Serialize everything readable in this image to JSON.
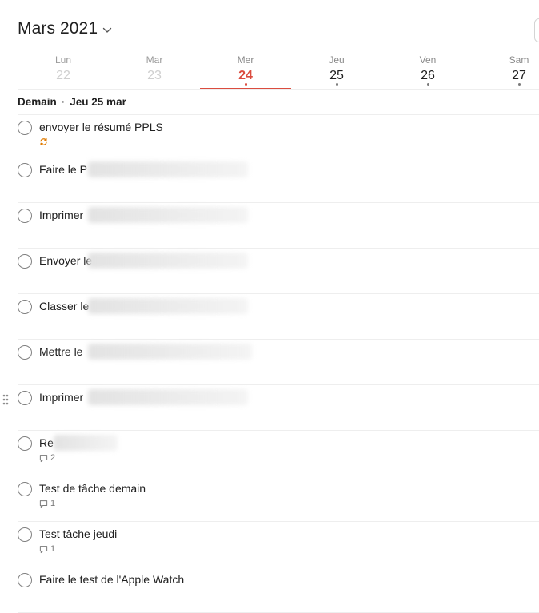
{
  "header": {
    "month": "Mars 2021"
  },
  "week": [
    {
      "name": "Lun",
      "num": "22",
      "state": "past"
    },
    {
      "name": "Mar",
      "num": "23",
      "state": "past"
    },
    {
      "name": "Mer",
      "num": "24",
      "state": "active"
    },
    {
      "name": "Jeu",
      "num": "25",
      "state": "future"
    },
    {
      "name": "Ven",
      "num": "26",
      "state": "future"
    },
    {
      "name": "Sam",
      "num": "27",
      "state": "future"
    }
  ],
  "section": {
    "label": "Demain",
    "separator": "·",
    "date": "Jeu 25 mar"
  },
  "tasks": [
    {
      "title": "envoyer le résumé PPLS",
      "meta_icon": "recurring-icon",
      "meta_text": ""
    },
    {
      "title": "Faire le P",
      "meta_icon": "",
      "meta_text": ""
    },
    {
      "title": "Imprimer",
      "meta_icon": "",
      "meta_text": ""
    },
    {
      "title": "Envoyer le",
      "meta_icon": "",
      "meta_text": ""
    },
    {
      "title": "Classer le",
      "meta_icon": "",
      "meta_text": ""
    },
    {
      "title": "Mettre le",
      "meta_icon": "",
      "meta_text": ""
    },
    {
      "title": "Imprimer",
      "meta_icon": "",
      "meta_text": ""
    },
    {
      "title": "Re",
      "meta_icon": "comment-icon",
      "meta_text": "2"
    },
    {
      "title": "Test de tâche demain",
      "meta_icon": "comment-icon",
      "meta_text": "1"
    },
    {
      "title": "Test tâche jeudi",
      "meta_icon": "comment-icon",
      "meta_text": "1"
    },
    {
      "title": "Faire le test de l'Apple Watch",
      "meta_icon": "",
      "meta_text": ""
    }
  ],
  "colors": {
    "accent": "#db4c3f",
    "recurring": "#e07b00",
    "divider": "#eeeeee"
  }
}
